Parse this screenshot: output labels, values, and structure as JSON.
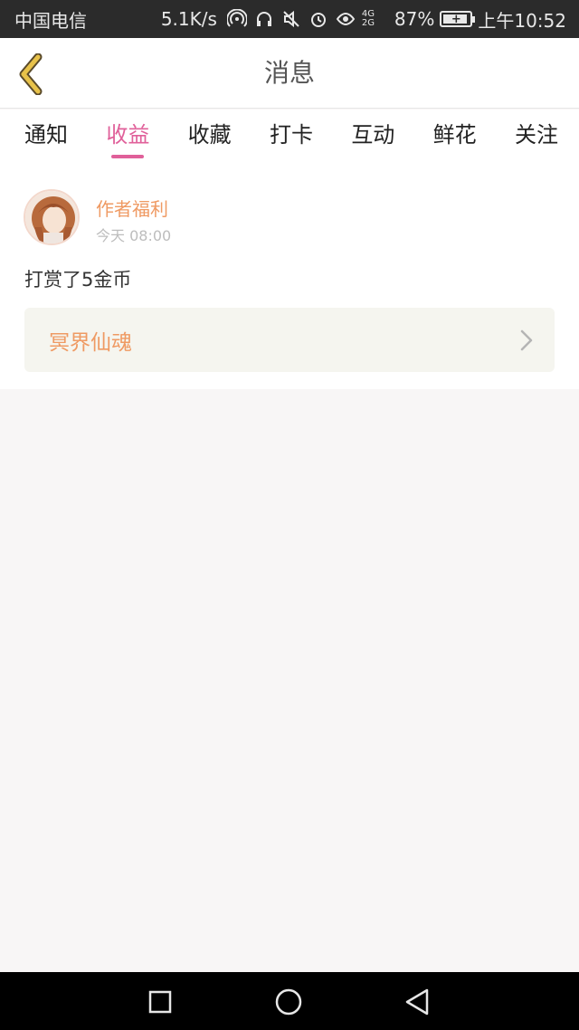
{
  "status_bar": {
    "carrier": "中国电信",
    "net_speed": "5.1K/s",
    "signal_text": "4G 2G",
    "battery": "87%",
    "time": "上午10:52",
    "icons": [
      "hotspot-icon",
      "headphones-icon",
      "mute-icon",
      "alarm-icon",
      "eye-icon",
      "signal-icon",
      "battery-icon"
    ]
  },
  "header": {
    "title": "消息",
    "back_icon": "chevron-left-icon"
  },
  "tabs": [
    {
      "label": "通知",
      "active": false
    },
    {
      "label": "收益",
      "active": true
    },
    {
      "label": "收藏",
      "active": false
    },
    {
      "label": "打卡",
      "active": false
    },
    {
      "label": "互动",
      "active": false
    },
    {
      "label": "鲜花",
      "active": false
    },
    {
      "label": "关注",
      "active": false
    }
  ],
  "messages": [
    {
      "sender": "作者福利",
      "time": "今天 08:00",
      "text": "打赏了5金币",
      "book_title": "冥界仙魂",
      "link_icon": "chevron-right-icon"
    }
  ],
  "nav_bar": {
    "icons": [
      "recent-apps-icon",
      "home-icon",
      "back-triangle-icon"
    ]
  },
  "colors": {
    "accent": "#e0609a",
    "orange_text": "#ef9a63",
    "back_arrow": "#e8c24a"
  }
}
